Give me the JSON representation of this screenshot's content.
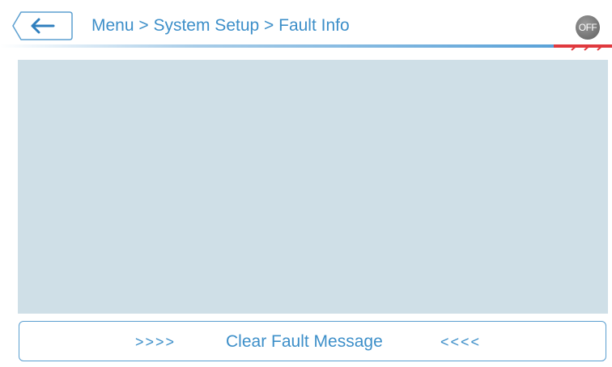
{
  "header": {
    "back_icon": "arrow-left-icon",
    "breadcrumb": "Menu > System Setup > Fault Info",
    "power_toggle_label": "OFF"
  },
  "fault_info": {
    "messages": []
  },
  "clear_button": {
    "left_arrows": ">>>>",
    "label": "Clear Fault Message",
    "right_arrows": "<<<<"
  },
  "colors": {
    "accent": "#3d8fc9",
    "panel": "#cfdfe7",
    "alert": "#e0393e",
    "toggle": "#808080"
  }
}
